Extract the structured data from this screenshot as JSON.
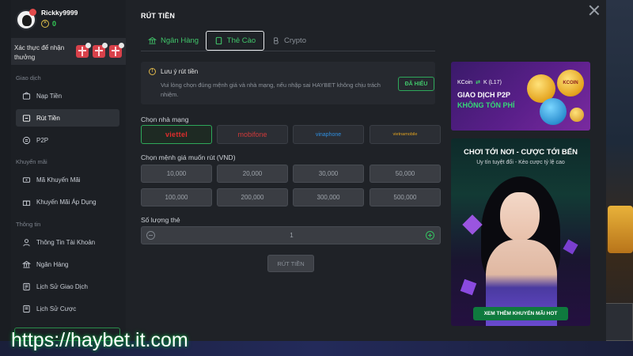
{
  "user": {
    "name": "Rickky9999",
    "balance": "0"
  },
  "sidebar": {
    "verify_text": "Xác thực để nhận thưởng",
    "sections": {
      "transactions": "Giao dịch",
      "promotions": "Khuyến mãi",
      "info": "Thông tin"
    },
    "items": [
      {
        "label": "Nạp Tiền",
        "icon": "deposit-icon"
      },
      {
        "label": "Rút Tiền",
        "icon": "withdraw-icon",
        "active": true
      },
      {
        "label": "P2P",
        "icon": "p2p-icon"
      },
      {
        "label": "Mã Khuyến Mãi",
        "icon": "promo-code-icon"
      },
      {
        "label": "Khuyến Mãi Áp Dụng",
        "icon": "gift-icon"
      },
      {
        "label": "Thông Tin Tài Khoản",
        "icon": "user-icon"
      },
      {
        "label": "Ngân Hàng",
        "icon": "bank-icon"
      },
      {
        "label": "Lịch Sử Giao Dịch",
        "icon": "history-icon"
      },
      {
        "label": "Lịch Sử Cược",
        "icon": "bet-history-icon"
      }
    ]
  },
  "modal": {
    "title": "RÚT TIỀN",
    "tabs": [
      {
        "label": "Ngân Hàng",
        "icon": "bank-icon"
      },
      {
        "label": "Thẻ Cào",
        "icon": "card-icon",
        "active": true
      },
      {
        "label": "Crypto",
        "icon": "bitcoin-icon"
      }
    ],
    "notice": {
      "title": "Lưu ý rút tiền",
      "body": "Vui lòng chọn đúng mệnh giá và nhà mạng, nếu nhập sai HAYBET không chịu trách nhiệm.",
      "button": "ĐÃ HIỂU"
    },
    "carrier_label": "Chọn nhà mạng",
    "carriers": [
      "viettel",
      "mobifone",
      "vinaphone",
      "vietnamobile"
    ],
    "selected_carrier": "viettel",
    "amount_label": "Chọn mệnh giá muốn rút (VND)",
    "amounts": [
      "10,000",
      "20,000",
      "30,000",
      "50,000",
      "100,000",
      "200,000",
      "300,000",
      "500,000"
    ],
    "quantity_label": "Số lượng thẻ",
    "quantity": "1",
    "submit": "RÚT TIỀN"
  },
  "banners": {
    "p2p": {
      "kcoin_left": "KCoin",
      "kcoin_right": "K (L17)",
      "title": "GIAO DỊCH P2P",
      "subtitle": "KHÔNG TỐN PHÍ",
      "coin_text": "KCOIN"
    },
    "promo": {
      "title": "CHƠI TỚI NƠI - CƯỢC TỚI BẾN",
      "subtitle": "Uy tín tuyệt đối - Kèo cược tỷ lệ cao",
      "button": "XEM THÊM KHUYẾN MÃI HOT"
    }
  },
  "watermark": "https://haybet.it.com",
  "colors": {
    "accent": "#41c46a",
    "danger": "#d8414a",
    "bg": "#1f2227"
  }
}
